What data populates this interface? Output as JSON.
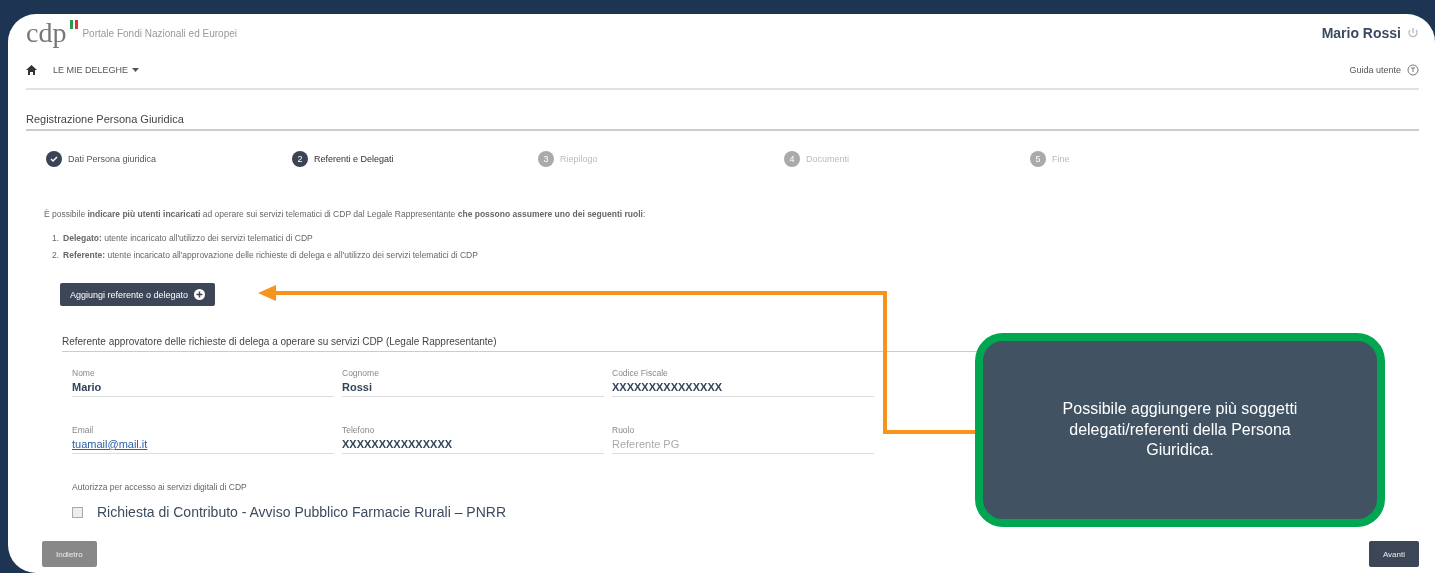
{
  "header": {
    "logo": "cdp",
    "portal_name": "Portale Fondi Nazionali ed Europei",
    "user_name": "Mario Rossi"
  },
  "nav": {
    "menu": "LE MIE DELEGHE",
    "help": "Guida utente"
  },
  "page_title": "Registrazione Persona Giuridica",
  "steps": [
    {
      "label": "Dati Persona giuridica",
      "done": true,
      "selected": false
    },
    {
      "label": "Referenti e Delegati",
      "number": "2",
      "done": false,
      "selected": true
    },
    {
      "label": "Riepilogo",
      "number": "3",
      "done": false,
      "selected": false
    },
    {
      "label": "Documenti",
      "number": "4",
      "done": false,
      "selected": false
    },
    {
      "label": "Fine",
      "number": "5",
      "done": false,
      "selected": false
    }
  ],
  "intro": "È possibile **indicare più utenti incaricati** ad operare sui servizi telematici di CDP dal Legale Rappresentante **che possono assumere uno dei seguenti ruoli**:",
  "roles": [
    {
      "marker": "1.",
      "text": "**Delegato:** utente incaricato all'utilizzo dei servizi telematici di CDP"
    },
    {
      "marker": "2.",
      "text": "**Referente:** utente incaricato all'approvazione delle richieste di delega e all'utilizzo dei servizi telematici di CDP"
    }
  ],
  "add_button": "Aggiungi referente o delegato",
  "section_title": "Referente approvatore delle richieste di delega a operare su servizi CDP (Legale Rappresentante)",
  "fields": [
    {
      "label": "Nome",
      "value": "Mario",
      "kind": "text"
    },
    {
      "label": "Cognome",
      "value": "Rossi",
      "kind": "text"
    },
    {
      "label": "Codice Fiscale",
      "value": "XXXXXXXXXXXXXXX",
      "kind": "text"
    },
    {
      "label": "Email",
      "value": "tuamail@mail.it",
      "kind": "link"
    },
    {
      "label": "Telefono",
      "value": "XXXXXXXXXXXXXXX",
      "kind": "text"
    },
    {
      "label": "Ruolo",
      "placeholder": "Referente PG",
      "kind": "placeholder"
    }
  ],
  "authorize": {
    "label": "Autorizza per accesso ai servizi digitali di CDP",
    "option": "Richiesta di Contributo - Avviso Pubblico Farmacie Rurali – PNRR",
    "checked": false
  },
  "buttons": {
    "back": "Indietro",
    "next": "Avanti"
  },
  "callout": "Possibile aggiungere più soggetti delegati/referenti della Persona Giuridica."
}
